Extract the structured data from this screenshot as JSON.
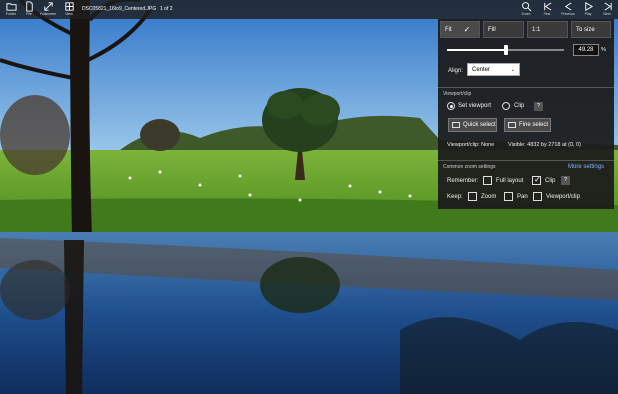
{
  "toolbar": {
    "left_buttons": [
      {
        "label": "Folder",
        "icon": "folder-icon"
      },
      {
        "label": "File",
        "icon": "file-icon"
      },
      {
        "label": "Fullscreen",
        "icon": "fullscreen-icon"
      },
      {
        "label": "View",
        "icon": "grid-view-icon"
      }
    ],
    "filename": "DSC05821_16to9_Centered.JPG",
    "page_count": "1 of 2",
    "right_buttons": [
      {
        "label": "Zoom",
        "icon": "zoom-icon"
      },
      {
        "label": "First",
        "icon": "first-icon"
      },
      {
        "label": "Previous",
        "icon": "previous-icon"
      },
      {
        "label": "Play",
        "icon": "play-icon"
      },
      {
        "label": "Next",
        "icon": "next-icon"
      }
    ]
  },
  "zoom_panel": {
    "fit_label": "Fit",
    "fill_label": "Fill",
    "one_to_one_label": "1:1",
    "to_size_label": "To size",
    "zoom_value": "49.28",
    "zoom_unit": "%",
    "zoom_slider_fraction": 0.5,
    "align_label": "Align:",
    "align_value": "Center",
    "viewport_section": "Viewport/clip",
    "set_viewport_label": "Set viewport",
    "clip_label": "Clip",
    "help_label": "?",
    "quick_select_label": "Quick select",
    "fine_select_label": "Fine select",
    "viewport_clip_status": "Viewport/clip: None",
    "visible_status": "Visible: 4832 by 2718 at (0, 0)",
    "common_settings_label": "Common zoom settings",
    "more_settings_label": "More settings",
    "remember_label": "Remember:",
    "full_layout_label": "Full layout",
    "clip_remember_label": "Clip",
    "keep_label": "Keep:",
    "keep_zoom_label": "Zoom",
    "keep_pan_label": "Pan",
    "keep_viewport_label": "Viewport/clip"
  }
}
